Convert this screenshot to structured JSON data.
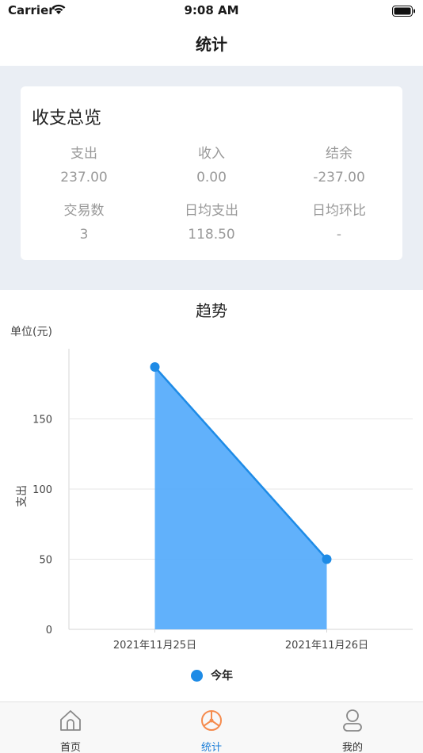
{
  "status_bar": {
    "carrier": "Carrier",
    "time": "9:08 AM"
  },
  "nav": {
    "title": "统计"
  },
  "summary": {
    "title": "收支总览",
    "stats": [
      {
        "label": "支出",
        "value": "237.00"
      },
      {
        "label": "收入",
        "value": "0.00"
      },
      {
        "label": "结余",
        "value": "-237.00"
      },
      {
        "label": "交易数",
        "value": "3"
      },
      {
        "label": "日均支出",
        "value": "118.50"
      },
      {
        "label": "日均环比",
        "value": "-"
      }
    ]
  },
  "trend": {
    "title": "趋势",
    "unit_label": "单位(元)",
    "legend": "今年"
  },
  "chart_data": {
    "type": "area",
    "categories": [
      "2021年11月25日",
      "2021年11月26日"
    ],
    "series": [
      {
        "name": "今年",
        "values": [
          187,
          50
        ]
      }
    ],
    "ylabel": "支出",
    "yticks": [
      0,
      50,
      100,
      150
    ],
    "ylim": [
      0,
      200
    ],
    "grid": true,
    "color": "#1e8be6",
    "fill_color": "#58adfb"
  },
  "tabs": [
    {
      "label": "首页",
      "icon": "home-icon",
      "active": false
    },
    {
      "label": "统计",
      "icon": "chart-icon",
      "active": true
    },
    {
      "label": "我的",
      "icon": "user-icon",
      "active": false
    }
  ],
  "colors": {
    "accent": "#1e7fd8",
    "chart_icon": "#f58b4d",
    "summary_bg": "#eaeef4"
  }
}
